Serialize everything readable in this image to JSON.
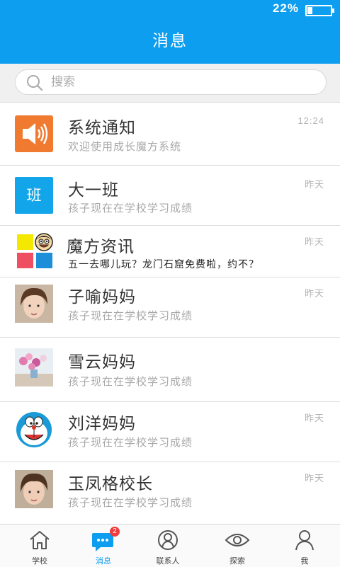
{
  "status": {
    "battery_text": "22%",
    "battery_level": 0.22
  },
  "header": {
    "title": "消息"
  },
  "search": {
    "placeholder": "搜索"
  },
  "messages": [
    {
      "name": "系统通知",
      "preview": "欢迎使用成长魔方系统",
      "time": "12:24",
      "avatar": "speaker-icon"
    },
    {
      "name": "大一班",
      "preview": "孩子现在在学校学习成绩",
      "time": "昨天",
      "avatar_text": "班"
    },
    {
      "name": "魔方资讯",
      "preview": "五一去哪儿玩？龙门石窟免费啦，约不？",
      "time": "昨天",
      "avatar": "mofang-logo"
    },
    {
      "name": "子喻妈妈",
      "preview": "孩子现在在学校学习成绩",
      "time": "昨天",
      "avatar": "user-photo"
    },
    {
      "name": "雪云妈妈",
      "preview": "孩子现在在学校学习成绩",
      "time": "",
      "avatar": "flowers-photo"
    },
    {
      "name": "刘洋妈妈",
      "preview": "孩子现在在学校学习成绩",
      "time": "昨天",
      "avatar": "doraemon-photo"
    },
    {
      "name": "玉凤格校长",
      "preview": "孩子现在在学校学习成绩",
      "time": "昨天",
      "avatar": "user-photo"
    }
  ],
  "tabs": [
    {
      "label": "学校",
      "icon": "home-icon"
    },
    {
      "label": "消息",
      "icon": "chat-icon",
      "badge": "2",
      "active": true
    },
    {
      "label": "联系人",
      "icon": "contacts-icon"
    },
    {
      "label": "探索",
      "icon": "eye-icon"
    },
    {
      "label": "我",
      "icon": "person-icon"
    }
  ],
  "colors": {
    "primary": "#0d9ef0",
    "notify_orange": "#f07a30",
    "badge_red": "#f03c3c"
  }
}
